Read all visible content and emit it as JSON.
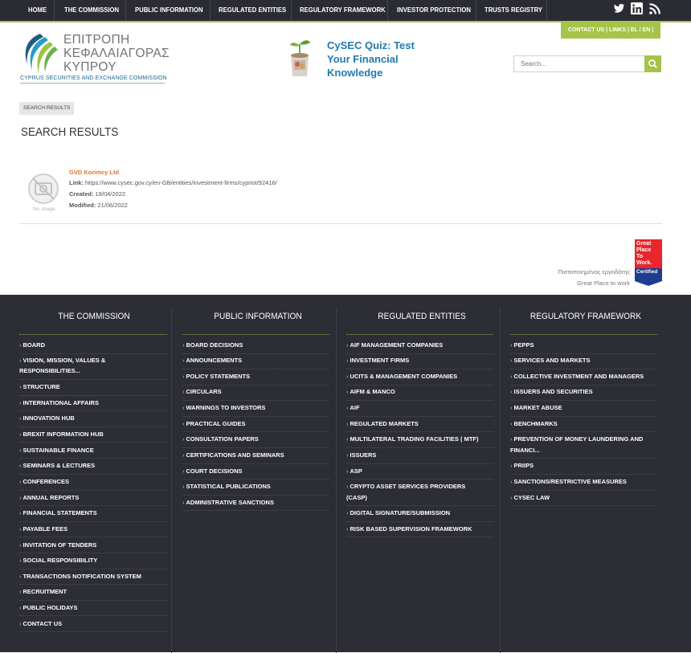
{
  "topnav": {
    "items": [
      "HOME",
      "THE COMMISSION",
      "PUBLIC INFORMATION",
      "REGULATED ENTITIES",
      "REGULATORY FRAMEWORK",
      "INVESTOR PROTECTION",
      "TRUSTS REGISTRY"
    ],
    "social": [
      "twitter-icon",
      "linkedin-icon",
      "rss-icon"
    ]
  },
  "contact_strip": "CONTACT US  |  LINKS  |  EL / EN  |",
  "logo": {
    "greek_line1": "ΕΠΙΤΡΟΠΗ",
    "greek_line2": "ΚΕΦΑΛΑΙΑΓΟΡΑΣ",
    "greek_line3": "ΚΥΠΡΟΥ",
    "english": "CYPRUS SECURITIES AND EXCHANGE COMMISSION"
  },
  "quiz": {
    "line1": "CySEC Quiz: Test",
    "line2": "Your Financial",
    "line3": "Knowledge"
  },
  "search": {
    "placeholder": "Search..."
  },
  "breadcrumb": "SEARCH RESULTS",
  "page_title": "SEARCH RESULTS",
  "result": {
    "no_image_label": "No image",
    "title": "GVD Korimcy Ltd",
    "link_label": "Link:",
    "link": "https://www.cysec.gov.cy/en-GB/entities/investment-firms/cypriot/92416/",
    "created_label": "Created:",
    "created": "18/04/2022",
    "modified_label": "Modified:",
    "modified": "21/06/2022"
  },
  "gptw": {
    "line1": "Πιστοποιημένος εργοδότης",
    "line2": "Great Place to work",
    "badge_line1": "Great",
    "badge_line2": "Place",
    "badge_line3": "To",
    "badge_line4": "Work.",
    "badge_certified": "Certified"
  },
  "footer": {
    "columns": [
      {
        "heading": "THE COMMISSION",
        "items": [
          "BOARD",
          "VISION, MISSION, VALUES &",
          "RESPONSIBILITIES...",
          "STRUCTURE",
          "INTERNATIONAL AFFAIRS",
          "INNOVATION HUB",
          "BREXIT INFORMATION HUB",
          "SUSTAINABLE FINANCE",
          "SEMINARS & LECTURES",
          "CONFERENCES",
          "ANNUAL REPORTS",
          "FINANCIAL STATEMENTS",
          "PAYABLE FEES",
          "INVITATION OF TENDERS",
          "SOCIAL RESPONSIBILITY",
          "TRANSACTIONS NOTIFICATION SYSTEM",
          "RECRUITMENT",
          "PUBLIC HOLIDAYS",
          "CONTACT US"
        ]
      },
      {
        "heading": "PUBLIC INFORMATION",
        "items": [
          "BOARD DECISIONS",
          "ANNOUNCEMENTS",
          "POLICY STATEMENTS",
          "CIRCULARS",
          "WARNINGS TO INVESTORS",
          "PRACTICAL GUIDES",
          "CONSULTATION PAPERS",
          "CERTIFICATIONS AND SEMINARS",
          "COURT DECISIONS",
          "STATISTICAL PUBLICATIONS",
          "ADMINISTRATIVE SANCTIONS"
        ]
      },
      {
        "heading": "REGULATED ENTITIES",
        "items": [
          "AIF MANAGEMENT COMPANIES",
          "INVESTMENT FIRMS",
          "UCITS & MANAGEMENT COMPANIES",
          "AIFM & MANCO",
          "AIF",
          "REGULATED MARKETS",
          "MULTILATERAL TRADING FACILITIES ( MTF)",
          "ISSUERS",
          "ASP",
          "CRYPTO ASSET SERVICES PROVIDERS",
          "(CASP)",
          "DIGITAL SIGNATURE/SUBMISSION",
          "RISK BASED SUPERVISION FRAMEWORK"
        ]
      },
      {
        "heading": "REGULATORY FRAMEWORK",
        "items": [
          "PEPPS",
          "SERVICES AND MARKETS",
          "COLLECTIVE INVESTMENT AND MANAGERS",
          "ISSUERS AND SECURITIES",
          "MARKET ABUSE",
          "BENCHMARKS",
          "PREVENTION OF MONEY LAUNDERING AND",
          "FINANCI...",
          "PRIIPS",
          "SANCTIONS/RESTRICTIVE MEASURES",
          "CYSEC LAW"
        ]
      }
    ]
  }
}
